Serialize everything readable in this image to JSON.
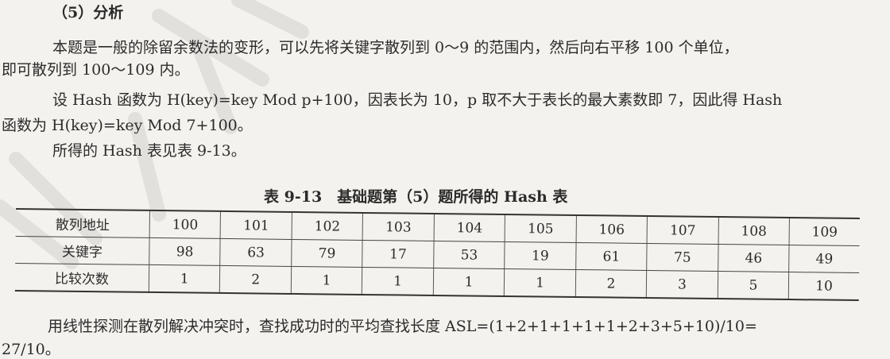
{
  "section_heading": "（5）分析",
  "paragraphs": {
    "p1_line1": "本题是一般的除留余数法的变形，可以先将关键字散列到 0～9 的范围内，然后向右平移 100 个单位，",
    "p1_line2": "即可散列到 100～109 内。",
    "p2_line1": "设 Hash 函数为 H(key)=key Mod p+100，因表长为 10，p 取不大于表长的最大素数即 7，因此得 Hash",
    "p2_line2": "函数为 H(key)=key Mod 7+100。",
    "p3": "所得的 Hash 表见表 9-13。",
    "p4_line1": "用线性探测在散列解决冲突时，查找成功时的平均查找长度 ASL=(1+2+1+1+1+1+2+3+5+10)/10=",
    "p4_line2": "27/10。"
  },
  "table": {
    "caption": "表 9-13　基础题第（5）题所得的 Hash 表",
    "rows": [
      {
        "header": "散列地址",
        "cells": [
          "100",
          "101",
          "102",
          "103",
          "104",
          "105",
          "106",
          "107",
          "108",
          "109"
        ]
      },
      {
        "header": "关键字",
        "cells": [
          "98",
          "63",
          "79",
          "17",
          "53",
          "19",
          "61",
          "75",
          "46",
          "49"
        ]
      },
      {
        "header": "比较次数",
        "cells": [
          "1",
          "2",
          "1",
          "1",
          "1",
          "1",
          "2",
          "3",
          "5",
          "10"
        ]
      }
    ]
  }
}
